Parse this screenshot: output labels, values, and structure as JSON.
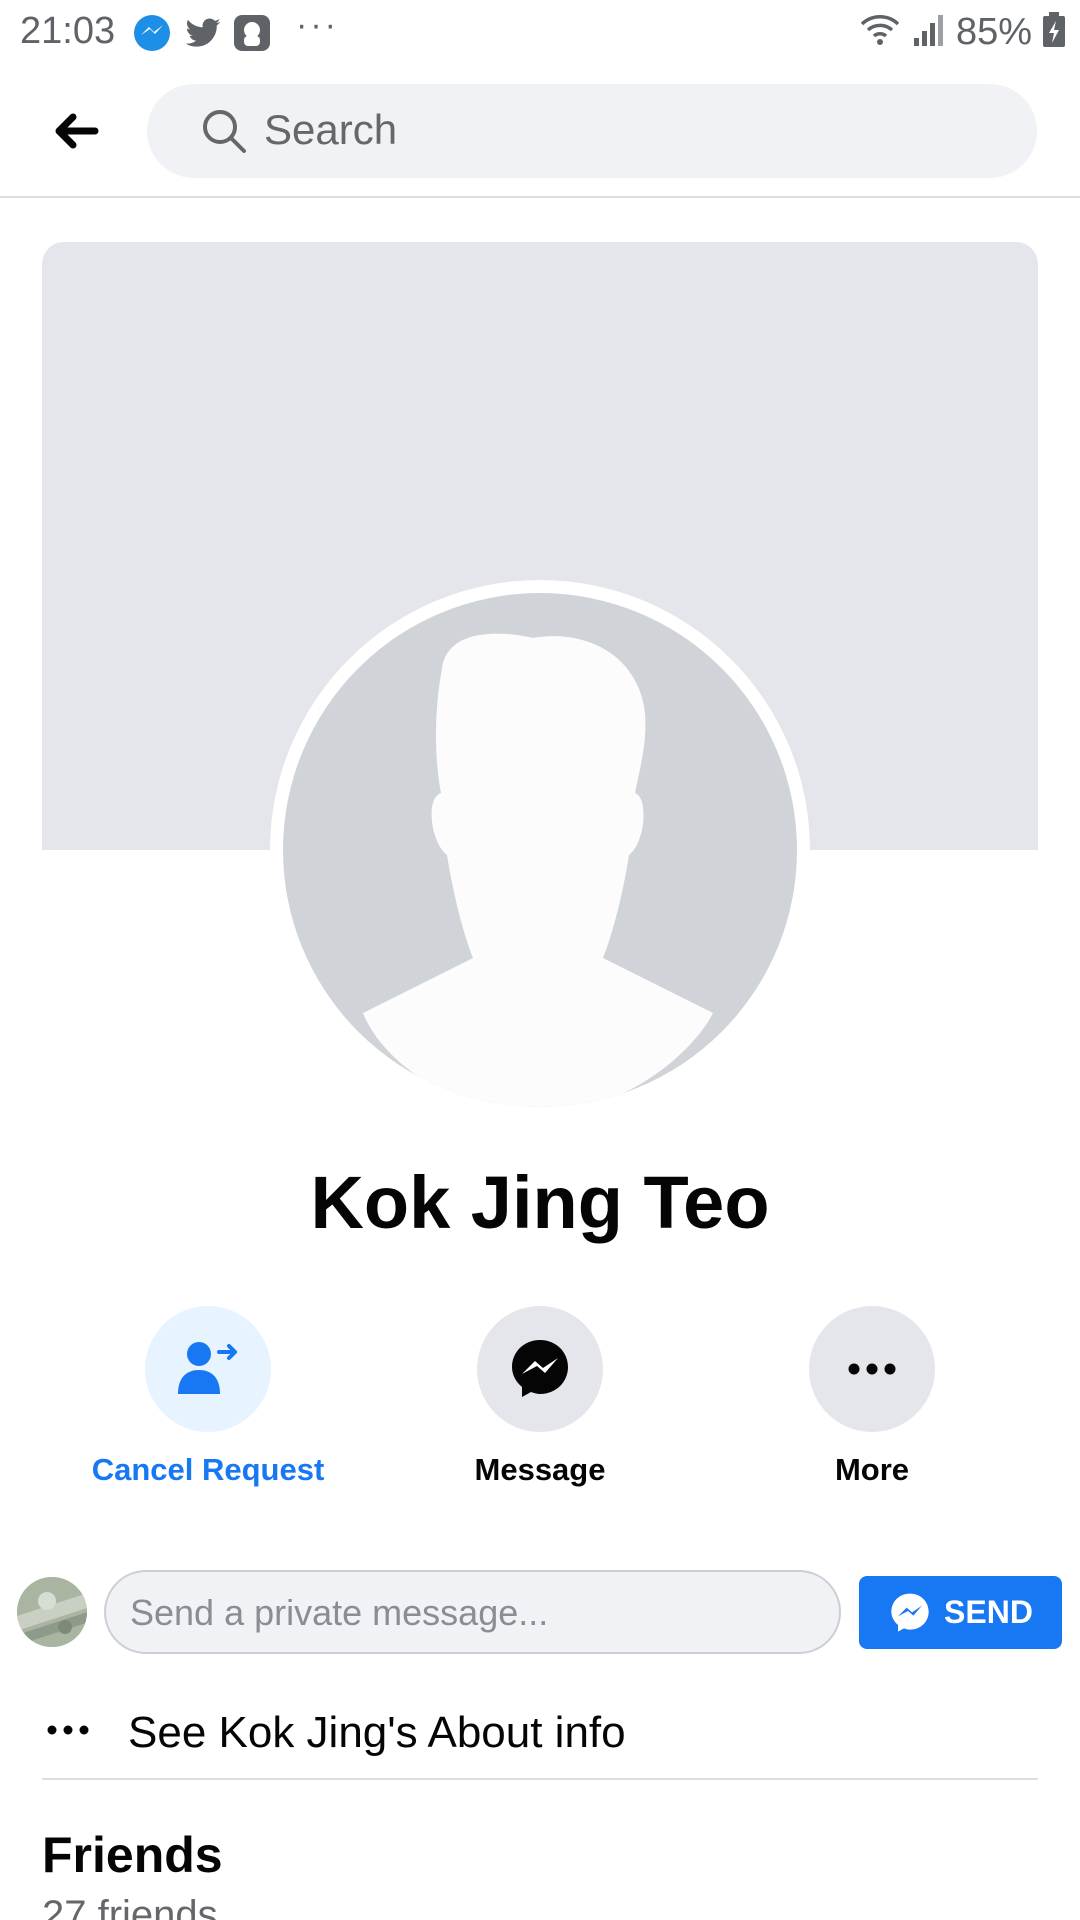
{
  "status_bar": {
    "time": "21:03",
    "more_dots": "···",
    "battery_percent": "85%",
    "icons": [
      "messenger-app-icon",
      "twitter-icon",
      "app-icon",
      "wifi-icon",
      "signal-icon",
      "battery-charging-icon"
    ]
  },
  "topbar": {
    "back_icon": "back-arrow-icon",
    "search_placeholder": "Search"
  },
  "profile": {
    "name": "Kok Jing Teo",
    "actions": [
      {
        "label": "Cancel Request",
        "icon": "user-request-icon",
        "color": "#1877f2",
        "bg": "#e7f3ff"
      },
      {
        "label": "Message",
        "icon": "messenger-icon",
        "color": "#050505",
        "bg": "#e4e6eb"
      },
      {
        "label": "More",
        "icon": "more-dots-icon",
        "color": "#050505",
        "bg": "#e4e6eb"
      }
    ]
  },
  "private_message": {
    "placeholder": "Send a private message...",
    "send_label": "SEND"
  },
  "about": {
    "text": "See Kok Jing's About info"
  },
  "friends": {
    "title": "Friends",
    "count": "27 friends"
  },
  "colors": {
    "accent": "#1877f2",
    "cover": "#e4e6eb",
    "avatar_bg": "#d0d3d8"
  }
}
